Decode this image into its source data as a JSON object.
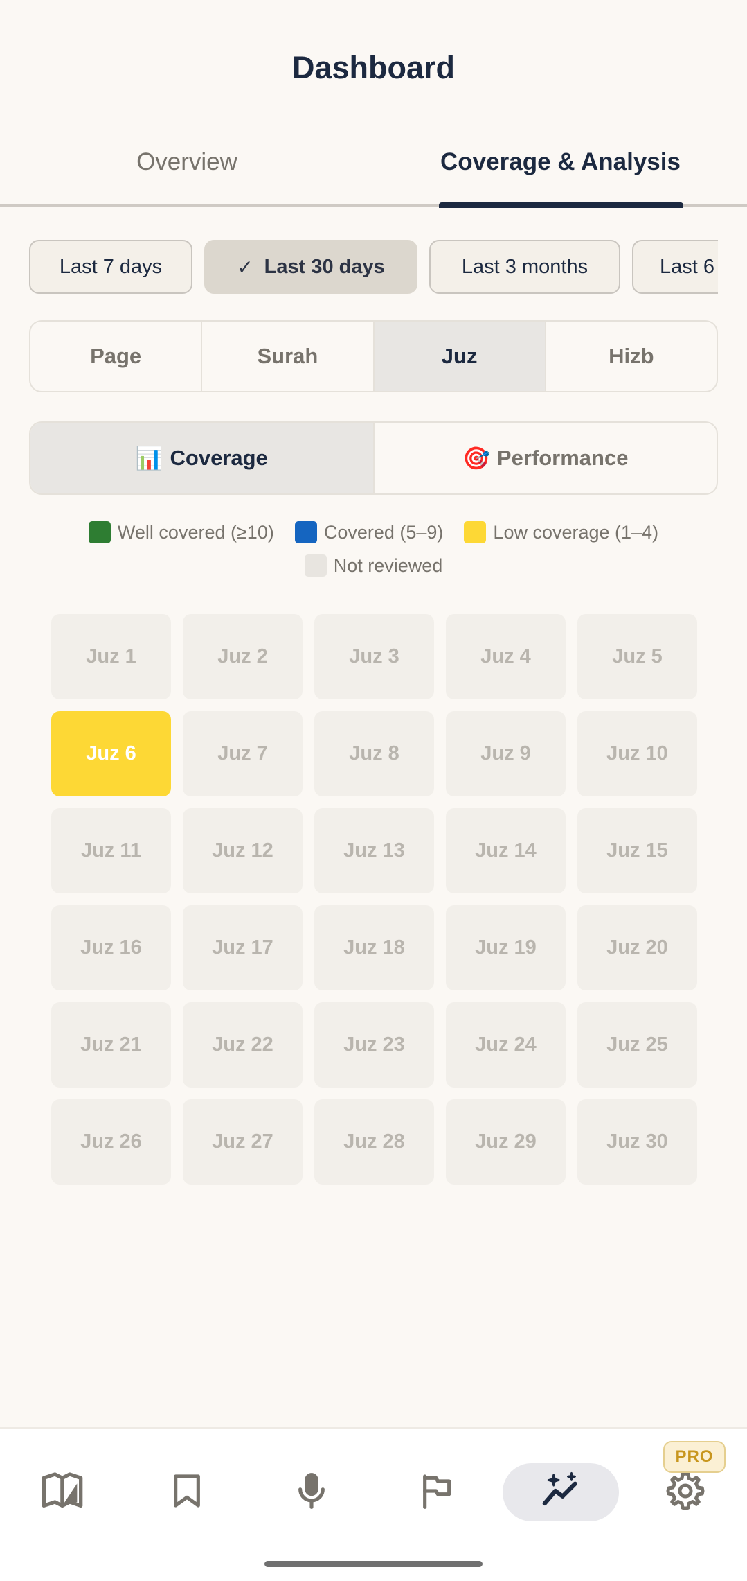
{
  "header": {
    "title": "Dashboard"
  },
  "tabs": [
    {
      "label": "Overview"
    },
    {
      "label": "Coverage & Analysis"
    }
  ],
  "periods": [
    {
      "label": "Last 7 days",
      "selected": false
    },
    {
      "label": "Last 30 days",
      "selected": true
    },
    {
      "label": "Last 3 months",
      "selected": false
    },
    {
      "label": "Last 6",
      "selected": false
    }
  ],
  "units": [
    {
      "label": "Page"
    },
    {
      "label": "Surah"
    },
    {
      "label": "Juz"
    },
    {
      "label": "Hizb"
    }
  ],
  "selected_unit": "Juz",
  "views": [
    {
      "icon": "📊",
      "label": "Coverage"
    },
    {
      "icon": "🎯",
      "label": "Performance"
    }
  ],
  "selected_view": "Coverage",
  "legend": [
    {
      "label": "Well covered (≥10)",
      "color": "#2e7d32"
    },
    {
      "label": "Covered (5–9)",
      "color": "#1565c0"
    },
    {
      "label": "Low coverage (1–4)",
      "color": "#fdd835"
    },
    {
      "label": "Not reviewed",
      "color": "#e8e5e0"
    }
  ],
  "juz": [
    {
      "label": "Juz 1",
      "status": "none"
    },
    {
      "label": "Juz 2",
      "status": "none"
    },
    {
      "label": "Juz 3",
      "status": "none"
    },
    {
      "label": "Juz 4",
      "status": "none"
    },
    {
      "label": "Juz 5",
      "status": "none"
    },
    {
      "label": "Juz 6",
      "status": "low"
    },
    {
      "label": "Juz 7",
      "status": "none"
    },
    {
      "label": "Juz 8",
      "status": "none"
    },
    {
      "label": "Juz 9",
      "status": "none"
    },
    {
      "label": "Juz 10",
      "status": "none"
    },
    {
      "label": "Juz 11",
      "status": "none"
    },
    {
      "label": "Juz 12",
      "status": "none"
    },
    {
      "label": "Juz 13",
      "status": "none"
    },
    {
      "label": "Juz 14",
      "status": "none"
    },
    {
      "label": "Juz 15",
      "status": "none"
    },
    {
      "label": "Juz 16",
      "status": "none"
    },
    {
      "label": "Juz 17",
      "status": "none"
    },
    {
      "label": "Juz 18",
      "status": "none"
    },
    {
      "label": "Juz 19",
      "status": "none"
    },
    {
      "label": "Juz 20",
      "status": "none"
    },
    {
      "label": "Juz 21",
      "status": "none"
    },
    {
      "label": "Juz 22",
      "status": "none"
    },
    {
      "label": "Juz 23",
      "status": "none"
    },
    {
      "label": "Juz 24",
      "status": "none"
    },
    {
      "label": "Juz 25",
      "status": "none"
    },
    {
      "label": "Juz 26",
      "status": "none"
    },
    {
      "label": "Juz 27",
      "status": "none"
    },
    {
      "label": "Juz 28",
      "status": "none"
    },
    {
      "label": "Juz 29",
      "status": "none"
    },
    {
      "label": "Juz 30",
      "status": "none"
    }
  ],
  "nav": {
    "items": [
      "book-icon",
      "bookmark-icon",
      "microphone-icon",
      "flag-icon",
      "analytics-icon",
      "gear-icon"
    ],
    "active": "analytics-icon",
    "pro_badge": "PRO"
  }
}
